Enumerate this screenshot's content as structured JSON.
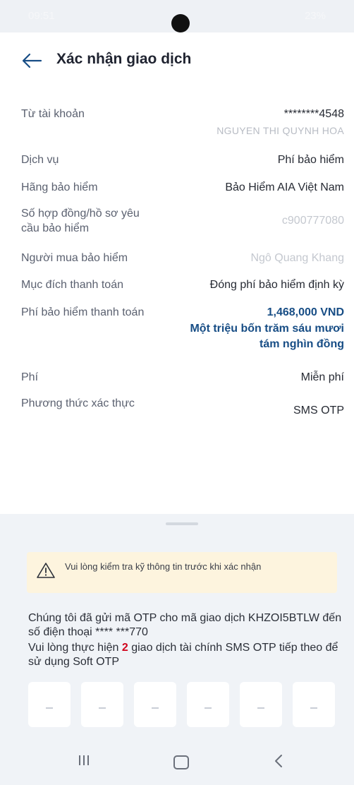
{
  "status_bar": {
    "time": "09:51",
    "battery": "23%"
  },
  "header": {
    "title": "Xác nhận giao dịch"
  },
  "details": [
    {
      "label": "Từ tài khoản",
      "value": "********4548",
      "sub": "NGUYEN THI QUYNH HOA"
    },
    {
      "label": "Dịch vụ",
      "value": "Phí bảo hiểm"
    },
    {
      "label": "Hãng bảo hiểm",
      "value": "Bảo Hiểm AIA Việt Nam"
    },
    {
      "label": "Số hợp đồng/hồ sơ yêu cầu bảo hiểm",
      "value": "c900777080"
    },
    {
      "label": "Người mua bảo hiểm",
      "value": "Ngô Quang Khang"
    },
    {
      "label": "Mục đích thanh toán",
      "value": "Đóng phí bảo hiểm định kỳ"
    },
    {
      "label": "Phí bảo hiểm thanh toán",
      "value": "1,468,000 VND",
      "sub": "Một triệu bốn trăm sáu mươi tám nghìn đồng"
    },
    {
      "label": "Phí",
      "value": "Miễn phí"
    },
    {
      "label": "Phương thức xác thực",
      "value": "SMS OTP"
    }
  ],
  "warning": {
    "text": "Vui lòng kiểm tra kỹ thông tin trước khi xác nhận"
  },
  "otp": {
    "message_1": "Chúng tôi đã gửi mã OTP cho mã giao dịch KHZOI5BTLW đến số điện thoại **** ***770",
    "message_2_prefix": "Vui lòng thực hiện ",
    "message_2_count": "2",
    "message_2_suffix": " giao dịch tài chính SMS OTP tiếp theo để sử dụng Soft OTP",
    "box_placeholder": "–"
  }
}
